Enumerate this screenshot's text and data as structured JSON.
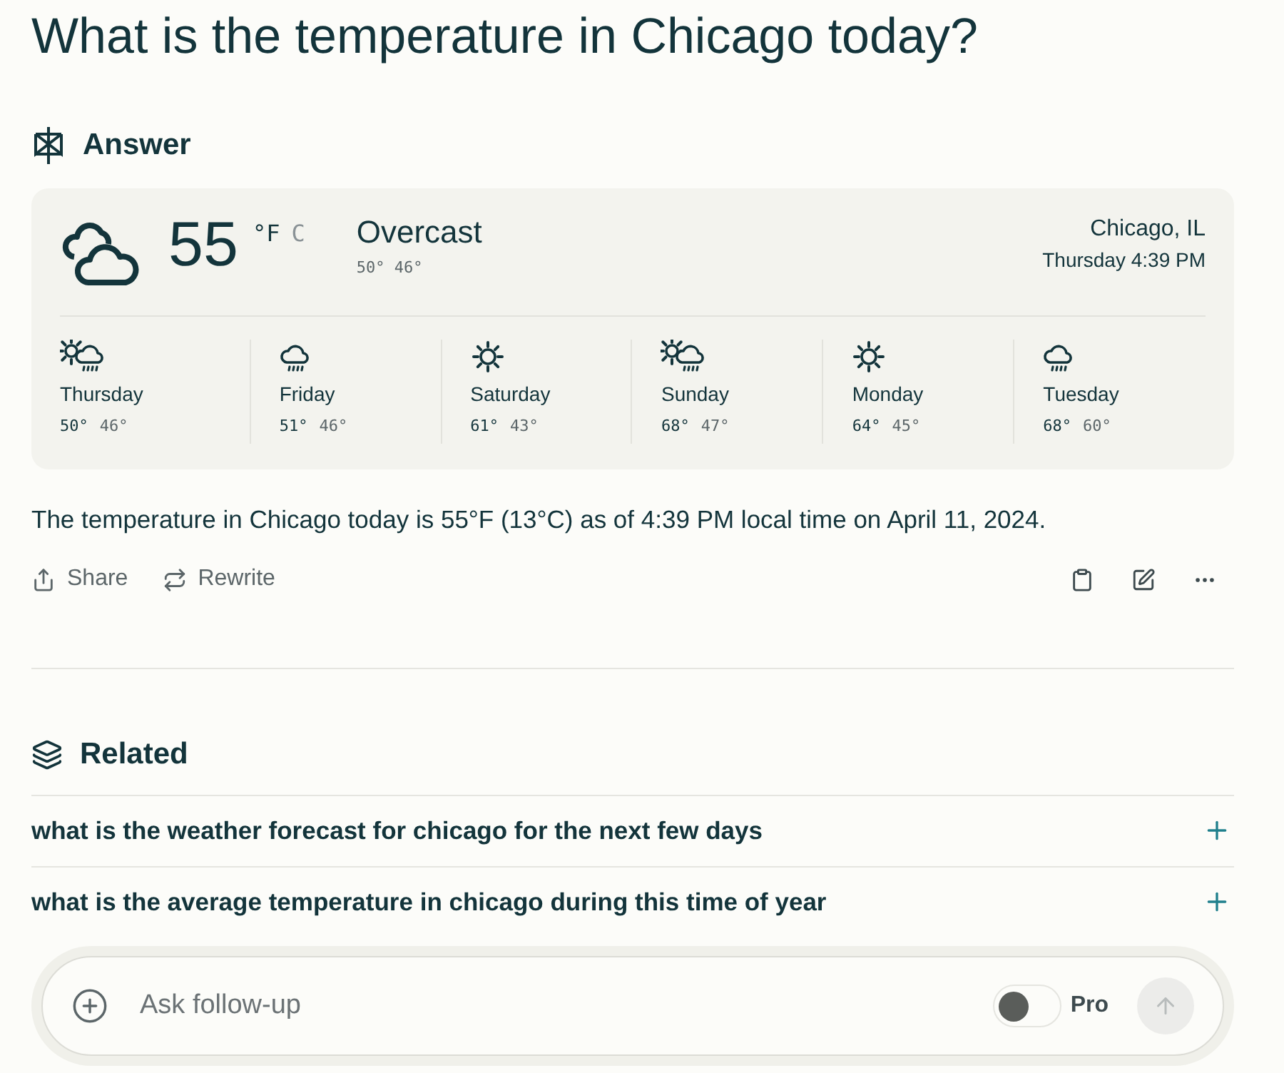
{
  "question": "What is the temperature in Chicago today?",
  "answer_heading": "Answer",
  "weather": {
    "temperature": "55",
    "units": [
      {
        "label": "°F",
        "selected": true
      },
      {
        "label": "C",
        "selected": false
      }
    ],
    "condition": "Overcast",
    "high_low": "50° 46°",
    "location": "Chicago, IL",
    "time": "Thursday 4:39 PM",
    "forecast": [
      {
        "day": "Thursday",
        "kind": "sun-rain",
        "high": "50°",
        "low": "46°"
      },
      {
        "day": "Friday",
        "kind": "rain",
        "high": "51°",
        "low": "46°"
      },
      {
        "day": "Saturday",
        "kind": "sun",
        "high": "61°",
        "low": "43°"
      },
      {
        "day": "Sunday",
        "kind": "sun-rain",
        "high": "68°",
        "low": "47°"
      },
      {
        "day": "Monday",
        "kind": "sun",
        "high": "64°",
        "low": "45°"
      },
      {
        "day": "Tuesday",
        "kind": "rain",
        "high": "68°",
        "low": "60°"
      }
    ]
  },
  "answer_text": "The temperature in Chicago today is 55°F (13°C) as of 4:39 PM local time on April 11, 2024.",
  "actions": [
    "Share",
    "Rewrite"
  ],
  "related_heading": "Related",
  "related": [
    "what is the weather forecast for chicago for the next few days",
    "what is the average temperature in chicago during this time of year"
  ],
  "follow_up": {
    "placeholder": "Ask follow-up",
    "pro_label": "Pro",
    "pro_on": false
  }
}
